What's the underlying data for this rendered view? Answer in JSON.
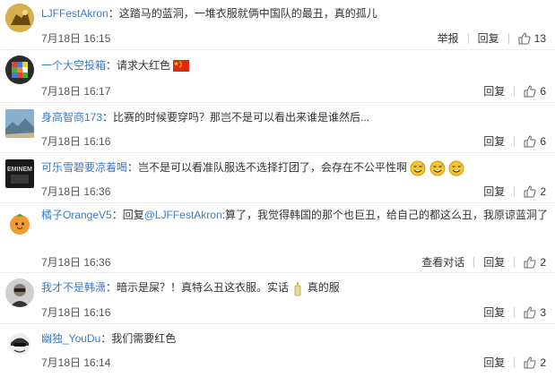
{
  "comments": [
    {
      "username": "LJFFestAkron",
      "text": "这踏马的蓝洞，一堆衣服就俩中国队的最丑，真的孤儿",
      "time": "7月18日 16:15",
      "actions": [
        "举报",
        "回复"
      ],
      "likes": "13"
    },
    {
      "username": "一个大空投箱",
      "text": "请求大红色",
      "time": "7月18日 16:17",
      "actions": [
        "回复"
      ],
      "likes": "6",
      "emoji": "china-flag"
    },
    {
      "username": "身高智商173",
      "text": "比赛的时候要穿吗？那岂不是可以看出来谁是谁然后...",
      "time": "7月18日 16:16",
      "actions": [
        "回复"
      ],
      "likes": "6"
    },
    {
      "username": "可乐雪碧要凉着喝",
      "text": "岂不是可以看准队服选不选择打团了，会存在不公平性啊",
      "time": "7月18日 16:36",
      "actions": [
        "回复"
      ],
      "likes": "2",
      "emoji": "sweat-smile-x3"
    },
    {
      "username": "橘子OrangeV5",
      "text_prefix": "回复",
      "mention": "@LJFFestAkron",
      "text": ":算了，我觉得韩国的那个也巨丑，给自己的都这么丑，我原谅蓝洞了",
      "time": "7月18日 16:36",
      "actions": [
        "查看对话",
        "回复"
      ],
      "likes": "2"
    },
    {
      "username": "我才不是韩潇",
      "text": "暗示是屎？！真特么丑这衣服。实话",
      "text_suffix": "真的服",
      "time": "7月18日 16:16",
      "actions": [
        "回复"
      ],
      "likes": "3",
      "emoji": "candle"
    },
    {
      "username": "幽独_YouDu",
      "text": "我们需要红色",
      "time": "7月18日 16:14",
      "actions": [
        "回复"
      ],
      "likes": "2"
    }
  ],
  "colors": {
    "username": "#3d7bc4",
    "text": "#333333",
    "divider": "#ececec"
  },
  "icons": {
    "like": "thumbs-up-icon"
  }
}
